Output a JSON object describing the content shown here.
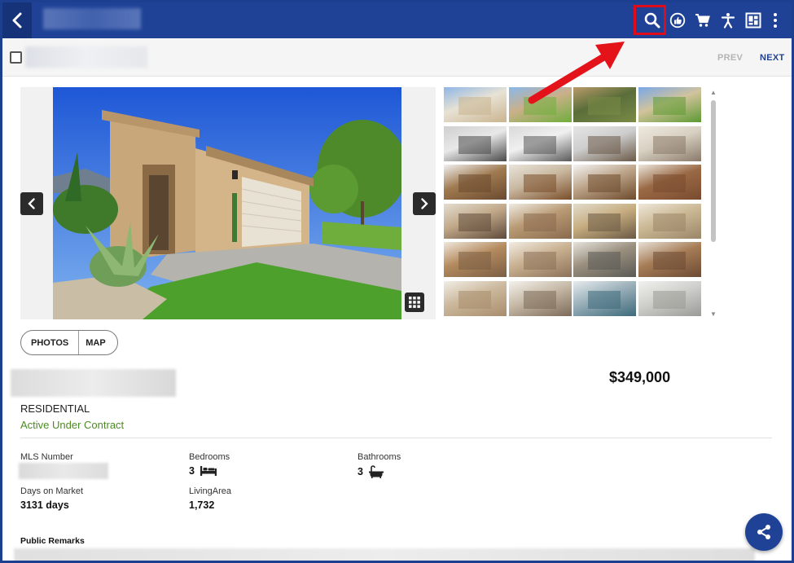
{
  "header": {
    "icons": [
      "search-icon",
      "thumbs-up-icon",
      "cart-icon",
      "accessibility-icon",
      "dashboard-icon",
      "more-vertical-icon"
    ]
  },
  "pagination": {
    "prev_label": "PREV",
    "next_label": "NEXT"
  },
  "view_toggle": {
    "photos_label": "PHOTOS",
    "map_label": "MAP"
  },
  "listing": {
    "property_type": "RESIDENTIAL",
    "status": "Active Under Contract",
    "price": "$349,000"
  },
  "facts": {
    "mls_label": "MLS Number",
    "bedrooms_label": "Bedrooms",
    "bedrooms_value": "3",
    "bathrooms_label": "Bathrooms",
    "bathrooms_value": "3",
    "days_label": "Days on Market",
    "days_value": "3131 days",
    "living_label": "LivingArea",
    "living_value": "1,732"
  },
  "remarks": {
    "label": "Public Remarks"
  },
  "colors": {
    "brand": "#1f4296",
    "status_green": "#4c8a24",
    "highlight_red": "#e10c1a"
  }
}
